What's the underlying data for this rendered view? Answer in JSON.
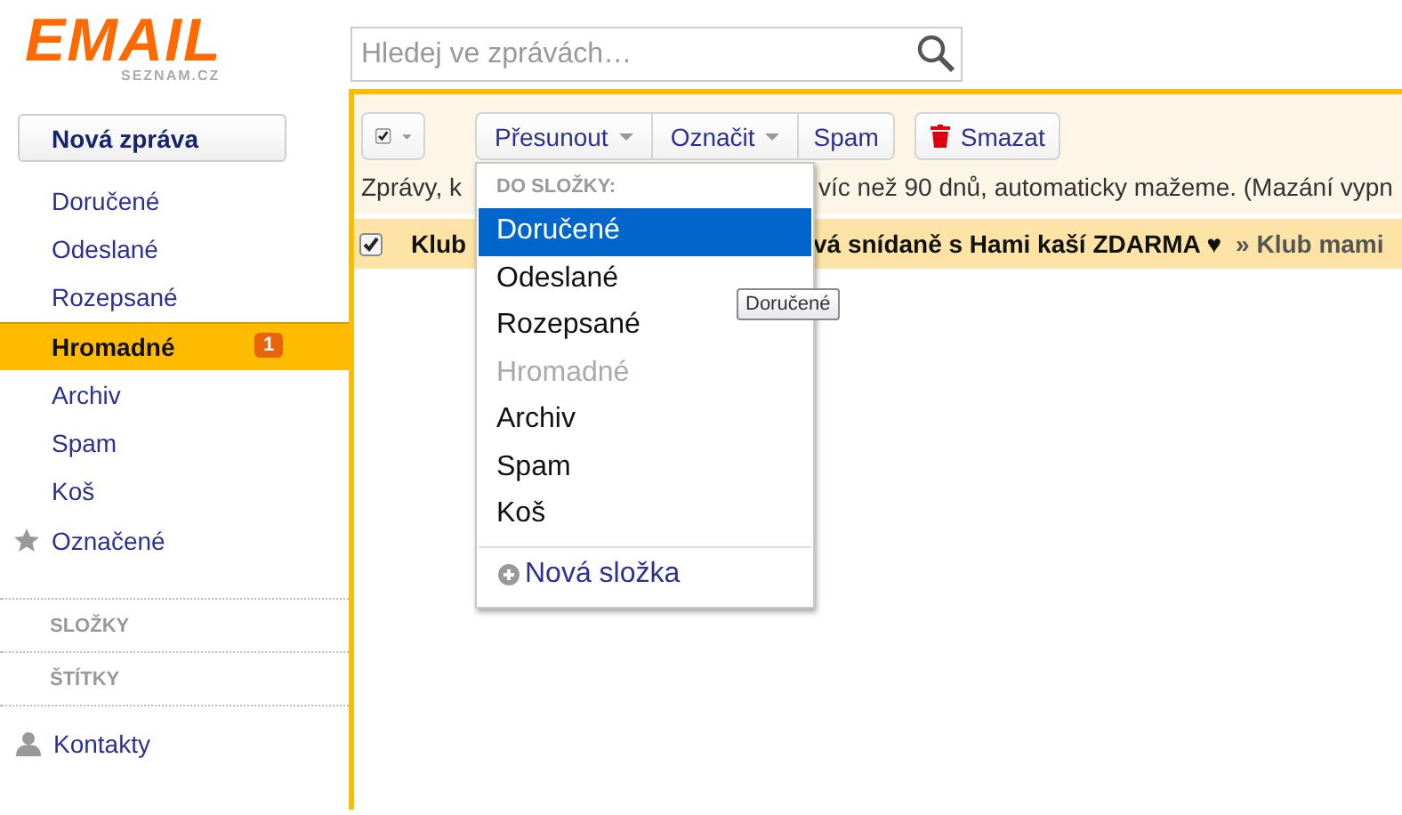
{
  "logo": {
    "word": "EMAIL",
    "domain": "SEZNAM.CZ"
  },
  "search": {
    "placeholder": "Hledej ve zprávách…"
  },
  "compose_button": "Nová zpráva",
  "folders": [
    {
      "label": "Doručené",
      "kind": "folder",
      "selected": false
    },
    {
      "label": "Odeslané",
      "kind": "folder",
      "selected": false
    },
    {
      "label": "Rozepsané",
      "kind": "folder",
      "selected": false
    },
    {
      "label": "Hromadné",
      "kind": "folder",
      "selected": true,
      "badge": "1"
    },
    {
      "label": "Archiv",
      "kind": "folder",
      "selected": false
    },
    {
      "label": "Spam",
      "kind": "folder",
      "selected": false
    },
    {
      "label": "Koš",
      "kind": "folder",
      "selected": false
    },
    {
      "label": "Označené",
      "kind": "starred",
      "selected": false
    }
  ],
  "sections": [
    "SLOŽKY",
    "ŠTÍTKY"
  ],
  "contacts": "Kontakty",
  "toolbar": {
    "select_all_checked": true,
    "buttons": [
      {
        "label": "Přesunout",
        "kind": "menu"
      },
      {
        "label": "Označit",
        "kind": "menu"
      },
      {
        "label": "Spam",
        "kind": "plain"
      }
    ],
    "delete_button": "Smazat"
  },
  "notice": [
    "Zprávy, k",
    "víc než 90 dnů, automaticky mažeme. (Mazání vypn"
  ],
  "message": {
    "checked": true,
    "sender": "Klub",
    "subject": "vá snídaně s Hami kaší ZDARMA ♥",
    "folder": "» Klub mami"
  },
  "dropdown": {
    "heading": "DO SLOŽKY:",
    "items": [
      {
        "label": "Doručené",
        "selected": true,
        "disabled": false
      },
      {
        "label": "Odeslané",
        "selected": false,
        "disabled": false
      },
      {
        "label": "Rozepsané",
        "selected": false,
        "disabled": false
      },
      {
        "label": "Hromadné",
        "selected": false,
        "disabled": true
      },
      {
        "label": "Archiv",
        "selected": false,
        "disabled": false
      },
      {
        "label": "Spam",
        "selected": false,
        "disabled": false
      },
      {
        "label": "Koš",
        "selected": false,
        "disabled": false
      }
    ],
    "new_folder": "Nová složka"
  },
  "tooltip": "Doručené"
}
